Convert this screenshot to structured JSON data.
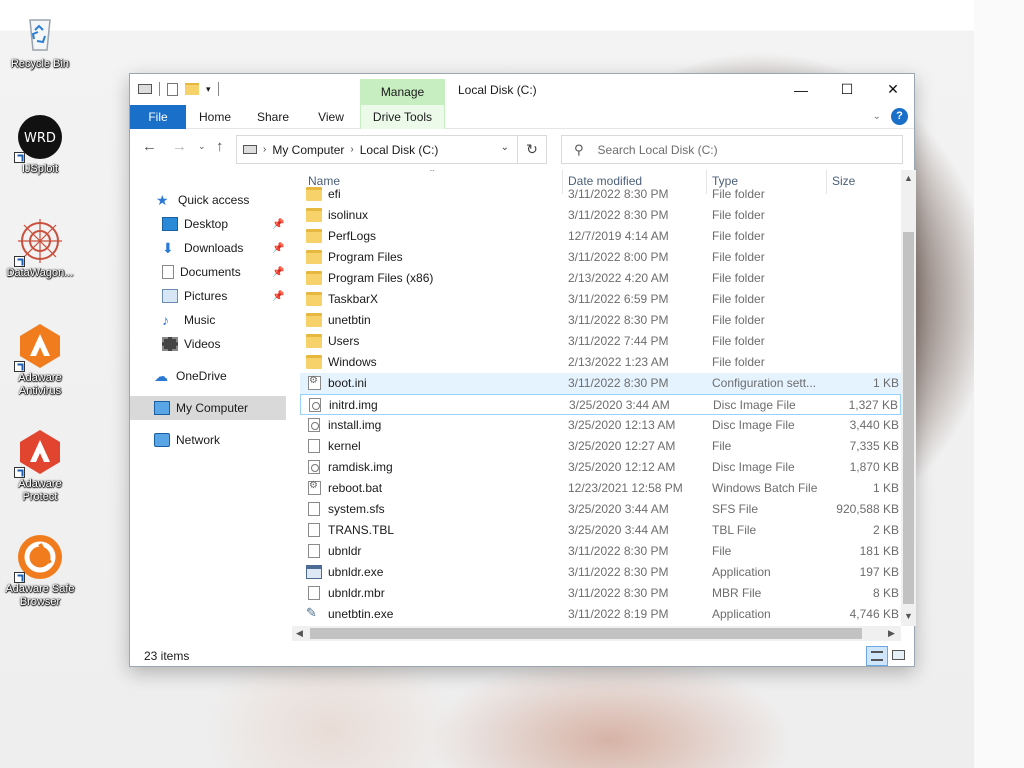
{
  "desktop": {
    "icons": [
      {
        "label": "Recycle Bin"
      },
      {
        "label": "IJSploit"
      },
      {
        "label": "DataWagon..."
      },
      {
        "label": "Adaware Antivirus"
      },
      {
        "label": "Adaware Protect"
      },
      {
        "label": "Adaware Safe Browser"
      }
    ]
  },
  "window": {
    "title": "Local Disk (C:)",
    "context_tab": "Manage",
    "ribbon_tabs": [
      "File",
      "Home",
      "Share",
      "View",
      "Drive Tools"
    ],
    "controls": {
      "minimize": "—",
      "maximize": "☐",
      "close": "✕"
    },
    "help": "?"
  },
  "address": {
    "crumbs": [
      "My Computer",
      "Local Disk (C:)"
    ]
  },
  "search": {
    "placeholder": "Search Local Disk (C:)"
  },
  "nav": {
    "quick_access": "Quick access",
    "pinned": [
      "Desktop",
      "Downloads",
      "Documents",
      "Pictures"
    ],
    "unpinned": [
      "Music",
      "Videos"
    ],
    "onedrive": "OneDrive",
    "my_computer": "My Computer",
    "network": "Network"
  },
  "columns": {
    "name": "Name",
    "date": "Date modified",
    "type": "Type",
    "size": "Size"
  },
  "files": [
    {
      "name": "efi",
      "date": "3/11/2022 8:30 PM",
      "type": "File folder",
      "size": "",
      "icon": "folder"
    },
    {
      "name": "isolinux",
      "date": "3/11/2022 8:30 PM",
      "type": "File folder",
      "size": "",
      "icon": "folder"
    },
    {
      "name": "PerfLogs",
      "date": "12/7/2019 4:14 AM",
      "type": "File folder",
      "size": "",
      "icon": "folder"
    },
    {
      "name": "Program Files",
      "date": "3/11/2022 8:00 PM",
      "type": "File folder",
      "size": "",
      "icon": "folder"
    },
    {
      "name": "Program Files (x86)",
      "date": "2/13/2022 4:20 AM",
      "type": "File folder",
      "size": "",
      "icon": "folder"
    },
    {
      "name": "TaskbarX",
      "date": "3/11/2022 6:59 PM",
      "type": "File folder",
      "size": "",
      "icon": "folder"
    },
    {
      "name": "unetbtin",
      "date": "3/11/2022 8:30 PM",
      "type": "File folder",
      "size": "",
      "icon": "folder"
    },
    {
      "name": "Users",
      "date": "3/11/2022 7:44 PM",
      "type": "File folder",
      "size": "",
      "icon": "folder"
    },
    {
      "name": "Windows",
      "date": "2/13/2022 1:23 AM",
      "type": "File folder",
      "size": "",
      "icon": "folder"
    },
    {
      "name": "boot.ini",
      "date": "3/11/2022 8:30 PM",
      "type": "Configuration sett...",
      "size": "1 KB",
      "icon": "gear-file"
    },
    {
      "name": "initrd.img",
      "date": "3/25/2020 3:44 AM",
      "type": "Disc Image File",
      "size": "1,327 KB",
      "icon": "disc-file"
    },
    {
      "name": "install.img",
      "date": "3/25/2020 12:13 AM",
      "type": "Disc Image File",
      "size": "3,440 KB",
      "icon": "disc-file"
    },
    {
      "name": "kernel",
      "date": "3/25/2020 12:27 AM",
      "type": "File",
      "size": "7,335 KB",
      "icon": "file"
    },
    {
      "name": "ramdisk.img",
      "date": "3/25/2020 12:12 AM",
      "type": "Disc Image File",
      "size": "1,870 KB",
      "icon": "disc-file"
    },
    {
      "name": "reboot.bat",
      "date": "12/23/2021 12:58 PM",
      "type": "Windows Batch File",
      "size": "1 KB",
      "icon": "gear-file"
    },
    {
      "name": "system.sfs",
      "date": "3/25/2020 3:44 AM",
      "type": "SFS File",
      "size": "920,588 KB",
      "icon": "file"
    },
    {
      "name": "TRANS.TBL",
      "date": "3/25/2020 3:44 AM",
      "type": "TBL File",
      "size": "2 KB",
      "icon": "file"
    },
    {
      "name": "ubnldr",
      "date": "3/11/2022 8:30 PM",
      "type": "File",
      "size": "181 KB",
      "icon": "file"
    },
    {
      "name": "ubnldr.exe",
      "date": "3/11/2022 8:30 PM",
      "type": "Application",
      "size": "197 KB",
      "icon": "app"
    },
    {
      "name": "ubnldr.mbr",
      "date": "3/11/2022 8:30 PM",
      "type": "MBR File",
      "size": "8 KB",
      "icon": "file"
    },
    {
      "name": "unetbtin.exe",
      "date": "3/11/2022 8:19 PM",
      "type": "Application",
      "size": "4,746 KB",
      "icon": "usb"
    }
  ],
  "status": {
    "item_count": "23 items"
  }
}
